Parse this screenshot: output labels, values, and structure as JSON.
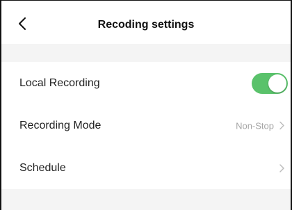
{
  "header": {
    "title": "Recoding settings",
    "back_icon": "chevron-left-icon"
  },
  "settings": {
    "local_recording": {
      "label": "Local Recording",
      "enabled": true
    },
    "recording_mode": {
      "label": "Recording Mode",
      "value": "Non-Stop"
    },
    "schedule": {
      "label": "Schedule"
    }
  },
  "colors": {
    "toggle_on": "#5ac26b",
    "secondary_text": "#a6a6a6",
    "section_gap": "#f4f4f4"
  }
}
